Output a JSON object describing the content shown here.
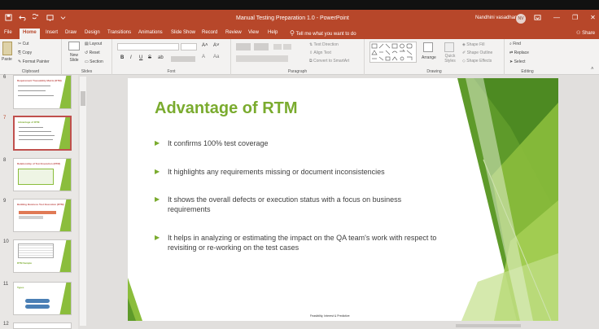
{
  "app": {
    "window_title": "Manual Testing Preparation 1.0  -  PowerPoint",
    "user_name": "Nandhini vasadhan",
    "avatar_initials": "NV"
  },
  "quick_access": {
    "save_icon": "save-icon",
    "undo_icon": "undo-icon",
    "redo_icon": "redo-icon",
    "present_icon": "present-icon"
  },
  "window_controls": {
    "options_icon": "ribbon-display-icon",
    "minimize": "—",
    "restore": "❐",
    "close": "✕"
  },
  "tabs": [
    {
      "label": "File"
    },
    {
      "label": "Home"
    },
    {
      "label": "Insert"
    },
    {
      "label": "Draw"
    },
    {
      "label": "Design"
    },
    {
      "label": "Transitions"
    },
    {
      "label": "Animations"
    },
    {
      "label": "Slide Show"
    },
    {
      "label": "Record"
    },
    {
      "label": "Review"
    },
    {
      "label": "View"
    },
    {
      "label": "Help"
    }
  ],
  "tell_me": "Tell me what you want to do",
  "share": "Share",
  "ribbon": {
    "clipboard": {
      "paste": "Paste",
      "cut": "Cut",
      "copy": "Copy",
      "format_painter": "Format Painter",
      "label": "Clipboard"
    },
    "slides": {
      "new_slide": "New Slide",
      "layout": "Layout",
      "reset": "Reset",
      "section": "Section",
      "label": "Slides"
    },
    "font": {
      "bold": "B",
      "italic": "I",
      "underline": "U",
      "strike": "S",
      "shadow": "ab",
      "label": "Font"
    },
    "paragraph": {
      "text_direction": "Text Direction",
      "align_text": "Align Text",
      "smartart": "Convert to SmartArt",
      "label": "Paragraph"
    },
    "drawing": {
      "arrange": "Arrange",
      "quick_styles": "Quick Styles",
      "shape_fill": "Shape Fill",
      "shape_outline": "Shape Outline",
      "shape_effects": "Shape Effects",
      "label": "Drawing"
    },
    "editing": {
      "find": "Find",
      "replace": "Replace",
      "select": "Select",
      "label": "Editing"
    }
  },
  "thumbnails": [
    {
      "num": "6",
      "title": "Requirement Traceability Matrix (RTM)",
      "active": false
    },
    {
      "num": "7",
      "title": "Advantage of RTM",
      "active": true
    },
    {
      "num": "8",
      "title": "Relationship of Test Execution (RTM)",
      "active": false
    },
    {
      "num": "9",
      "title": "Building Business Test Execution (RTM)",
      "active": false
    },
    {
      "num": "10",
      "title": "RTM Sample",
      "active": false
    },
    {
      "num": "11",
      "title": "Types",
      "active": false
    },
    {
      "num": "12",
      "title": "",
      "active": false
    }
  ],
  "slide": {
    "title": "Advantage of RTM",
    "bullets": [
      "It confirms 100% test coverage",
      "It highlights any requirements missing or document inconsistencies",
      "It shows the overall defects or execution status with a focus on business requirements",
      "It helps in analyzing or estimating the impact on the QA team's work with respect to revisiting or re-working on the test cases"
    ],
    "footer": "Feasibility, Interest & Predictive",
    "accent_color": "#7aab2e"
  },
  "colors": {
    "ppt_red": "#b7472a",
    "green_dark": "#5e9a2a",
    "green_light": "#8bbd3c"
  }
}
